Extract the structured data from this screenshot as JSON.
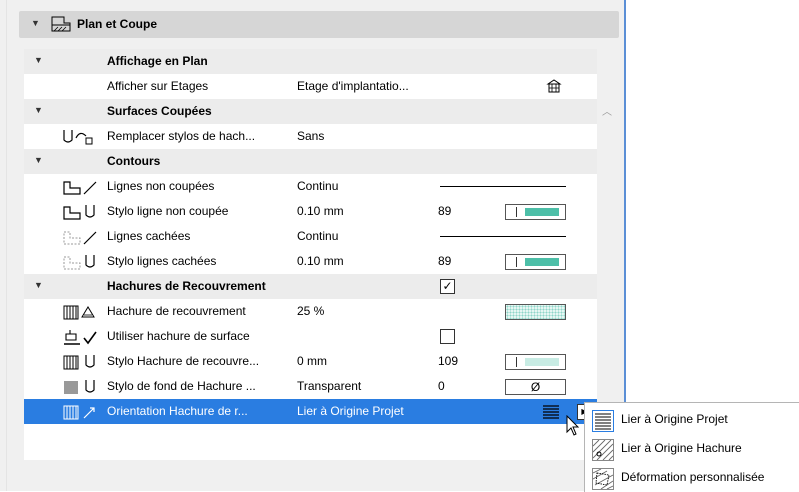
{
  "section": {
    "title": "Plan et Coupe"
  },
  "groups": {
    "affichage": "Affichage en Plan",
    "surfaces": "Surfaces Coupées",
    "contours": "Contours",
    "hachures": "Hachures de Recouvrement"
  },
  "rows": {
    "afficher_etages": {
      "label": "Afficher sur Etages",
      "value": "Etage d'implantatio..."
    },
    "remplacer_stylos": {
      "label": "Remplacer stylos de hach...",
      "value": "Sans"
    },
    "lignes_non_coupees": {
      "label": "Lignes non coupées",
      "value": "Continu"
    },
    "stylo_ligne_non_coupee": {
      "label": "Stylo ligne non coupée",
      "value": "0.10 mm",
      "num": "89"
    },
    "lignes_cachees": {
      "label": "Lignes cachées",
      "value": "Continu"
    },
    "stylo_lignes_cachees": {
      "label": "Stylo lignes cachées",
      "value": "0.10 mm",
      "num": "89"
    },
    "hachure_recouvrement": {
      "label": "Hachure de recouvrement",
      "value": "25 %"
    },
    "utiliser_hachure": {
      "label": "Utiliser hachure de surface"
    },
    "stylo_hachure": {
      "label": "Stylo Hachure de recouvre...",
      "value": "0 mm",
      "num": "109"
    },
    "stylo_fond": {
      "label": "Stylo de fond de Hachure ...",
      "value": "Transparent",
      "num": "0",
      "swatch": "Ø"
    },
    "orientation": {
      "label": "Orientation Hachure de r...",
      "value": "Lier à Origine Projet"
    }
  },
  "checks": {
    "hachures_group": "✓"
  },
  "dropdown": {
    "items": [
      {
        "label": "Lier à Origine Projet"
      },
      {
        "label": "Lier à Origine Hachure"
      },
      {
        "label": "Déformation personnalisée"
      }
    ]
  },
  "colors": {
    "selection": "#2a7de1",
    "pen_fill": "#4dbfa8",
    "group_bg": "#ececec"
  }
}
